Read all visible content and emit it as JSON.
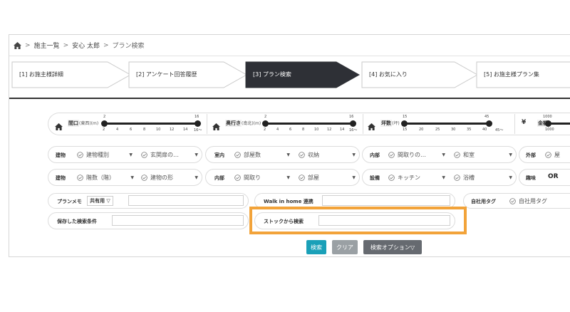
{
  "breadcrumb": {
    "items": [
      "施主一覧",
      "安心 太郎",
      "プラン検索"
    ],
    "separator": ">"
  },
  "steps": [
    {
      "label": "[1]  お施主様詳細",
      "active": false
    },
    {
      "label": "[2]  アンケート回答履歴",
      "active": false
    },
    {
      "label": "[3]  プラン検索",
      "active": true
    },
    {
      "label": "[4]  お気に入り",
      "active": false
    },
    {
      "label": "[5]  お施主様プラン集",
      "active": false
    }
  ],
  "sliders": [
    {
      "label": "間口",
      "unit": "(東西)(m)",
      "min_label": "2",
      "max_label": "16",
      "ticks": [
        "2",
        "4",
        "6",
        "8",
        "10",
        "12",
        "14",
        "16〜"
      ],
      "range": [
        2,
        16
      ]
    },
    {
      "label": "奥行き",
      "unit": "(南北)(m)",
      "min_label": "2",
      "max_label": "16",
      "ticks": [
        "2",
        "4",
        "6",
        "8",
        "10",
        "12",
        "14",
        "16〜"
      ],
      "range": [
        2,
        16
      ]
    },
    {
      "label": "坪数",
      "unit": "(坪)",
      "min_label": "15",
      "max_label": "45",
      "ticks": [
        "15",
        "20",
        "25",
        "30",
        "35",
        "40",
        "45〜"
      ],
      "range": [
        15,
        45
      ]
    },
    {
      "label": "金額",
      "currency": "¥",
      "min_label": "1000",
      "ticks": [
        "1000"
      ]
    }
  ],
  "row1": {
    "building": {
      "label": "建物",
      "fields": [
        "建物種別",
        "玄関扉の…"
      ]
    },
    "interior": {
      "label": "室内",
      "fields": [
        "部屋数",
        "収納"
      ]
    },
    "parts": {
      "label": "内部",
      "fields": [
        "間取りの…",
        "和室"
      ]
    },
    "exterior": {
      "label": "外部",
      "fields": [
        "屋"
      ]
    }
  },
  "row2": {
    "building": {
      "label": "建物",
      "fields": [
        "階数（階）",
        "建物の形"
      ]
    },
    "interior": {
      "label": "内部",
      "fields": [
        "間取り",
        "部屋"
      ]
    },
    "equipment": {
      "label": "設備",
      "fields": [
        "キッチン",
        "浴槽"
      ]
    },
    "hobby": {
      "label": "趣味",
      "value": "OR"
    }
  },
  "plan_memo": {
    "label": "プランメモ",
    "badge": "共有用 ▽",
    "value": ""
  },
  "walk_in_home": {
    "label": "Walk in home 連携",
    "value": ""
  },
  "company_tag": {
    "label": "自社用タグ",
    "placeholder": "自社用タグ"
  },
  "saved_search": {
    "label": "保存した検索条件",
    "value": ""
  },
  "stock_search": {
    "label": "ストックから検索",
    "value": ""
  },
  "buttons": {
    "search": "検索",
    "clear": "クリア",
    "options": "検索オプション▽"
  },
  "colors": {
    "active_step": "#2e3036",
    "search_button": "#1aa0b8",
    "clear_button": "#9aa0a4",
    "options_button": "#666a70",
    "highlight": "#f2a33a"
  }
}
